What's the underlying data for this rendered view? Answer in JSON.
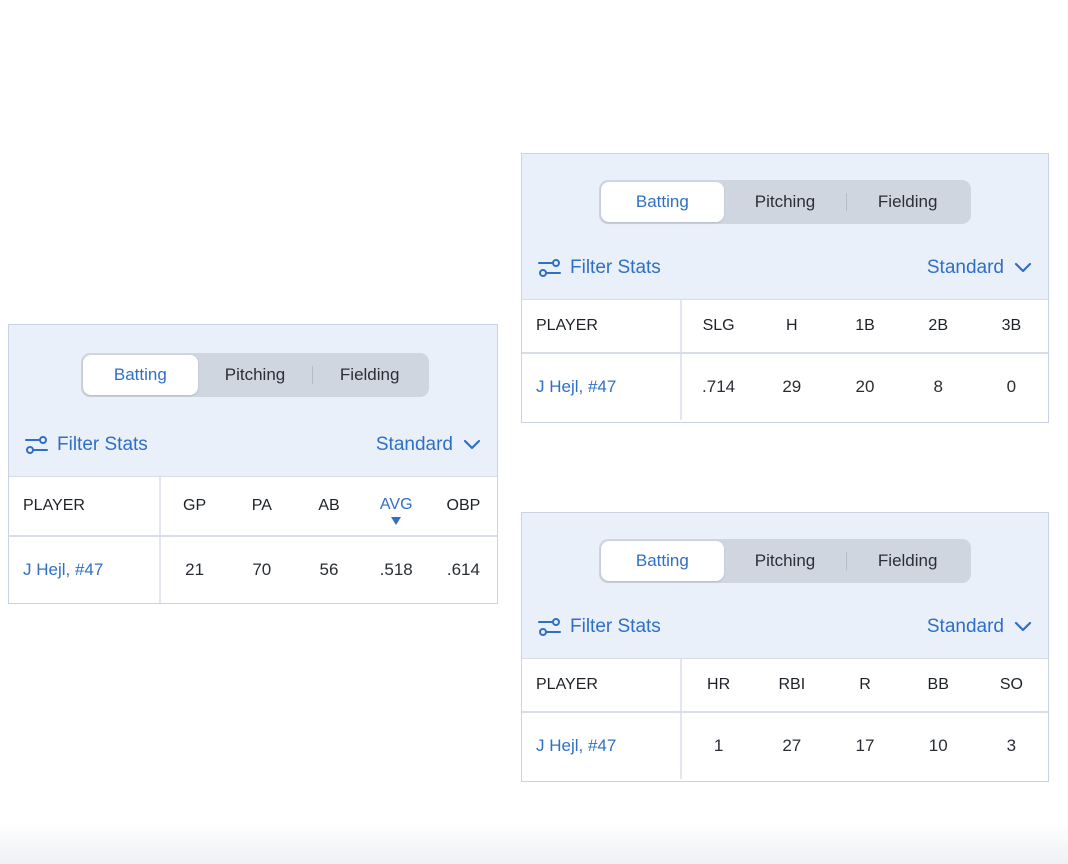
{
  "tabs": [
    "Batting",
    "Pitching",
    "Fielding"
  ],
  "filter_label": "Filter Stats",
  "view_label": "Standard",
  "colors": {
    "accent": "#2f6fc6",
    "panel_bg": "#eaf0f9",
    "segment_bg": "#cfd6e0"
  },
  "icons": {
    "filter": "filter-sliders-icon",
    "dropdown": "chevron-down-icon",
    "sort": "sort-desc-icon"
  },
  "tables": [
    {
      "columns": [
        "PLAYER",
        "GP",
        "PA",
        "AB",
        "AVG",
        "OBP"
      ],
      "sorted_column": "AVG",
      "row": [
        "J Hejl, #47",
        "21",
        "70",
        "56",
        ".518",
        ".614"
      ]
    },
    {
      "columns": [
        "PLAYER",
        "SLG",
        "H",
        "1B",
        "2B",
        "3B"
      ],
      "row": [
        "J Hejl, #47",
        ".714",
        "29",
        "20",
        "8",
        "0"
      ]
    },
    {
      "columns": [
        "PLAYER",
        "HR",
        "RBI",
        "R",
        "BB",
        "SO"
      ],
      "row": [
        "J Hejl, #47",
        "1",
        "27",
        "17",
        "10",
        "3"
      ]
    }
  ]
}
